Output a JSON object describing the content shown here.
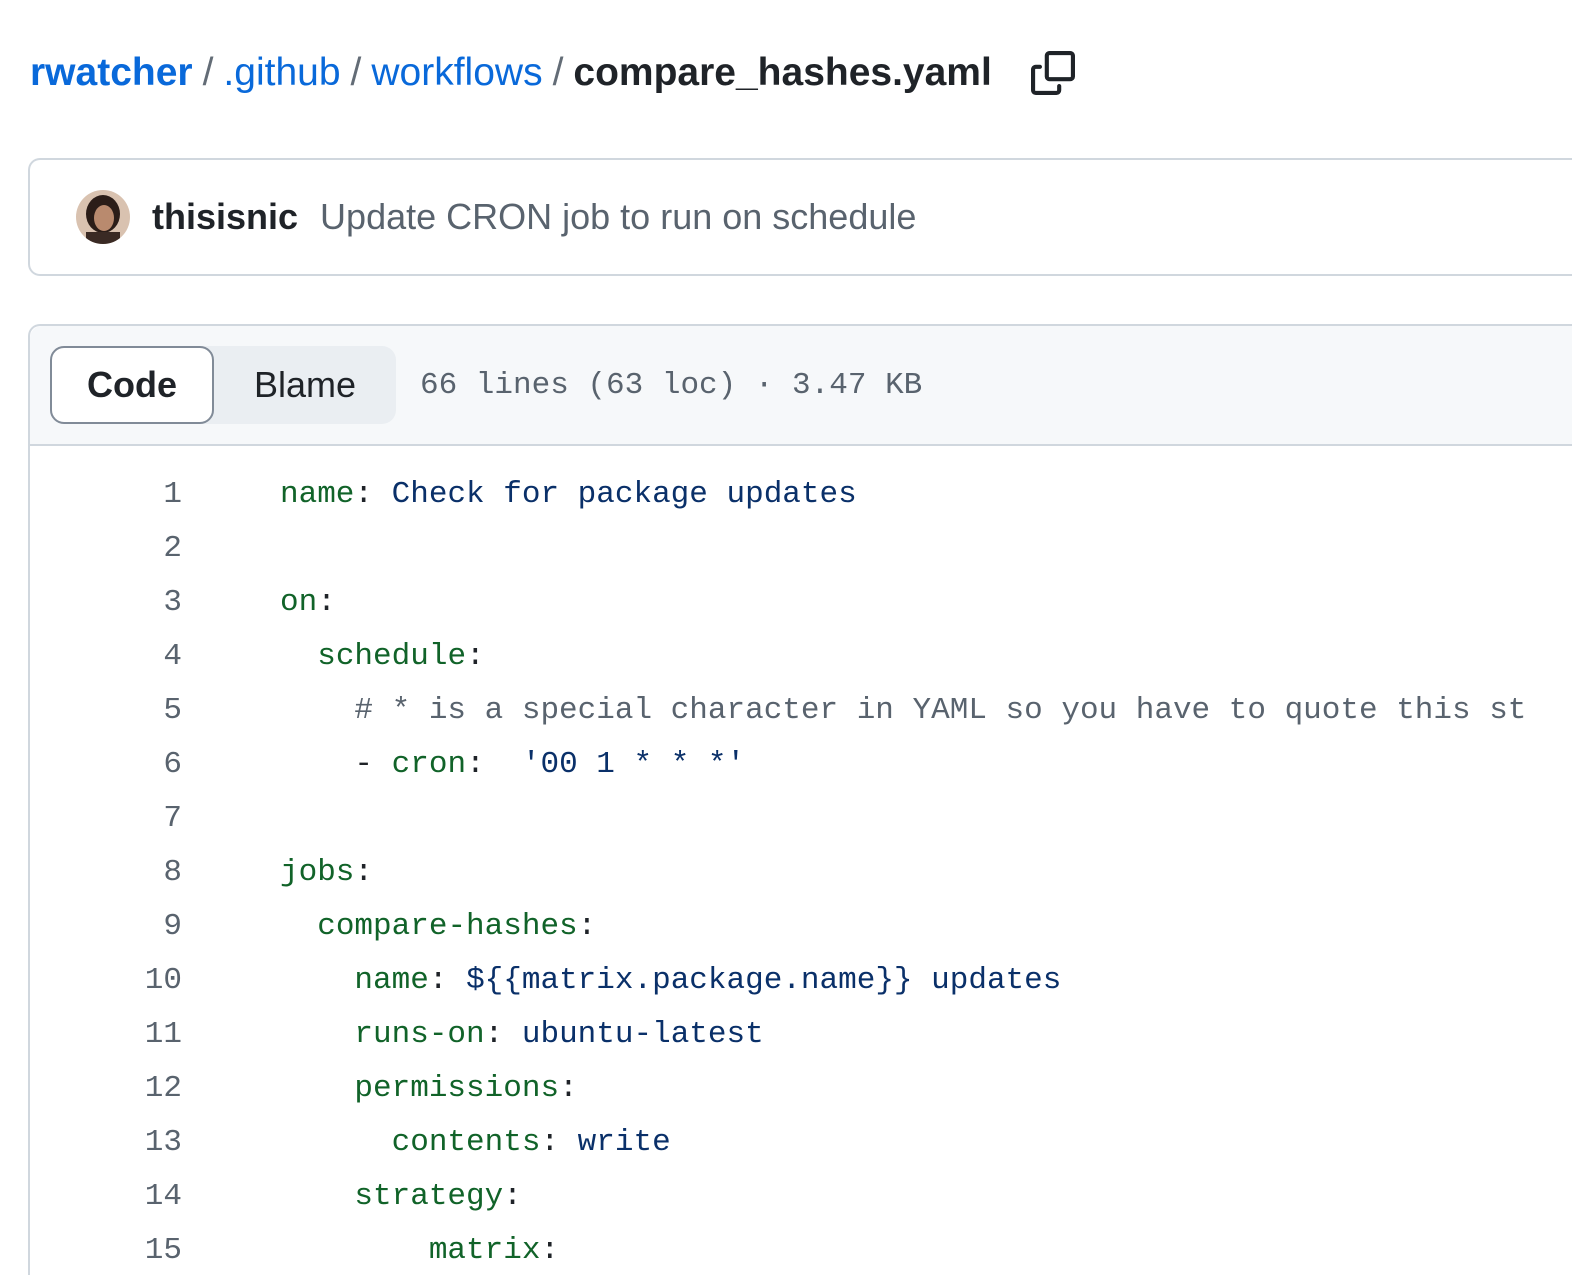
{
  "breadcrumb": {
    "repo": "rwatcher",
    "separator": "/",
    "folders": [
      ".github",
      "workflows"
    ],
    "file": "compare_hashes.yaml",
    "copy_icon": "copy-icon"
  },
  "commit": {
    "author": "thisisnic",
    "message": "Update CRON job to run on schedule"
  },
  "file_header": {
    "tabs": [
      {
        "label": "Code",
        "selected": true
      },
      {
        "label": "Blame",
        "selected": false
      }
    ],
    "meta": "66 lines (63 loc) · 3.47 KB"
  },
  "code": {
    "lines": [
      {
        "num": "1",
        "indent": "",
        "tokens": [
          {
            "t": "name",
            "c": "key"
          },
          {
            "t": ": ",
            "c": "punc"
          },
          {
            "t": "Check for package updates",
            "c": "val"
          }
        ]
      },
      {
        "num": "2",
        "indent": "",
        "tokens": []
      },
      {
        "num": "3",
        "indent": "",
        "tokens": [
          {
            "t": "on",
            "c": "key"
          },
          {
            "t": ":",
            "c": "punc"
          }
        ]
      },
      {
        "num": "4",
        "indent": "  ",
        "tokens": [
          {
            "t": "schedule",
            "c": "key"
          },
          {
            "t": ":",
            "c": "punc"
          }
        ]
      },
      {
        "num": "5",
        "indent": "    ",
        "tokens": [
          {
            "t": "# * is a special character in YAML so you have to quote this st",
            "c": "com"
          }
        ]
      },
      {
        "num": "6",
        "indent": "    ",
        "tokens": [
          {
            "t": "- ",
            "c": "punc"
          },
          {
            "t": "cron",
            "c": "key"
          },
          {
            "t": ":  ",
            "c": "punc"
          },
          {
            "t": "'00 1 * * *'",
            "c": "val"
          }
        ]
      },
      {
        "num": "7",
        "indent": "",
        "tokens": []
      },
      {
        "num": "8",
        "indent": "",
        "tokens": [
          {
            "t": "jobs",
            "c": "key"
          },
          {
            "t": ":",
            "c": "punc"
          }
        ]
      },
      {
        "num": "9",
        "indent": "  ",
        "tokens": [
          {
            "t": "compare-hashes",
            "c": "key"
          },
          {
            "t": ":",
            "c": "punc"
          }
        ]
      },
      {
        "num": "10",
        "indent": "    ",
        "tokens": [
          {
            "t": "name",
            "c": "key"
          },
          {
            "t": ": ",
            "c": "punc"
          },
          {
            "t": "${{matrix.package.name}} updates",
            "c": "val"
          }
        ]
      },
      {
        "num": "11",
        "indent": "    ",
        "tokens": [
          {
            "t": "runs-on",
            "c": "key"
          },
          {
            "t": ": ",
            "c": "punc"
          },
          {
            "t": "ubuntu-latest",
            "c": "val"
          }
        ]
      },
      {
        "num": "12",
        "indent": "    ",
        "tokens": [
          {
            "t": "permissions",
            "c": "key"
          },
          {
            "t": ":",
            "c": "punc"
          }
        ]
      },
      {
        "num": "13",
        "indent": "      ",
        "tokens": [
          {
            "t": "contents",
            "c": "key"
          },
          {
            "t": ": ",
            "c": "punc"
          },
          {
            "t": "write",
            "c": "val"
          }
        ]
      },
      {
        "num": "14",
        "indent": "    ",
        "tokens": [
          {
            "t": "strategy",
            "c": "key"
          },
          {
            "t": ":",
            "c": "punc"
          }
        ]
      },
      {
        "num": "15",
        "indent": "        ",
        "tokens": [
          {
            "t": "matrix",
            "c": "key"
          },
          {
            "t": ":",
            "c": "punc"
          }
        ]
      }
    ]
  },
  "colors": {
    "link": "#0969da",
    "key": "#116329",
    "value": "#0a3069",
    "comment": "#59636e",
    "border": "#d0d7de"
  }
}
